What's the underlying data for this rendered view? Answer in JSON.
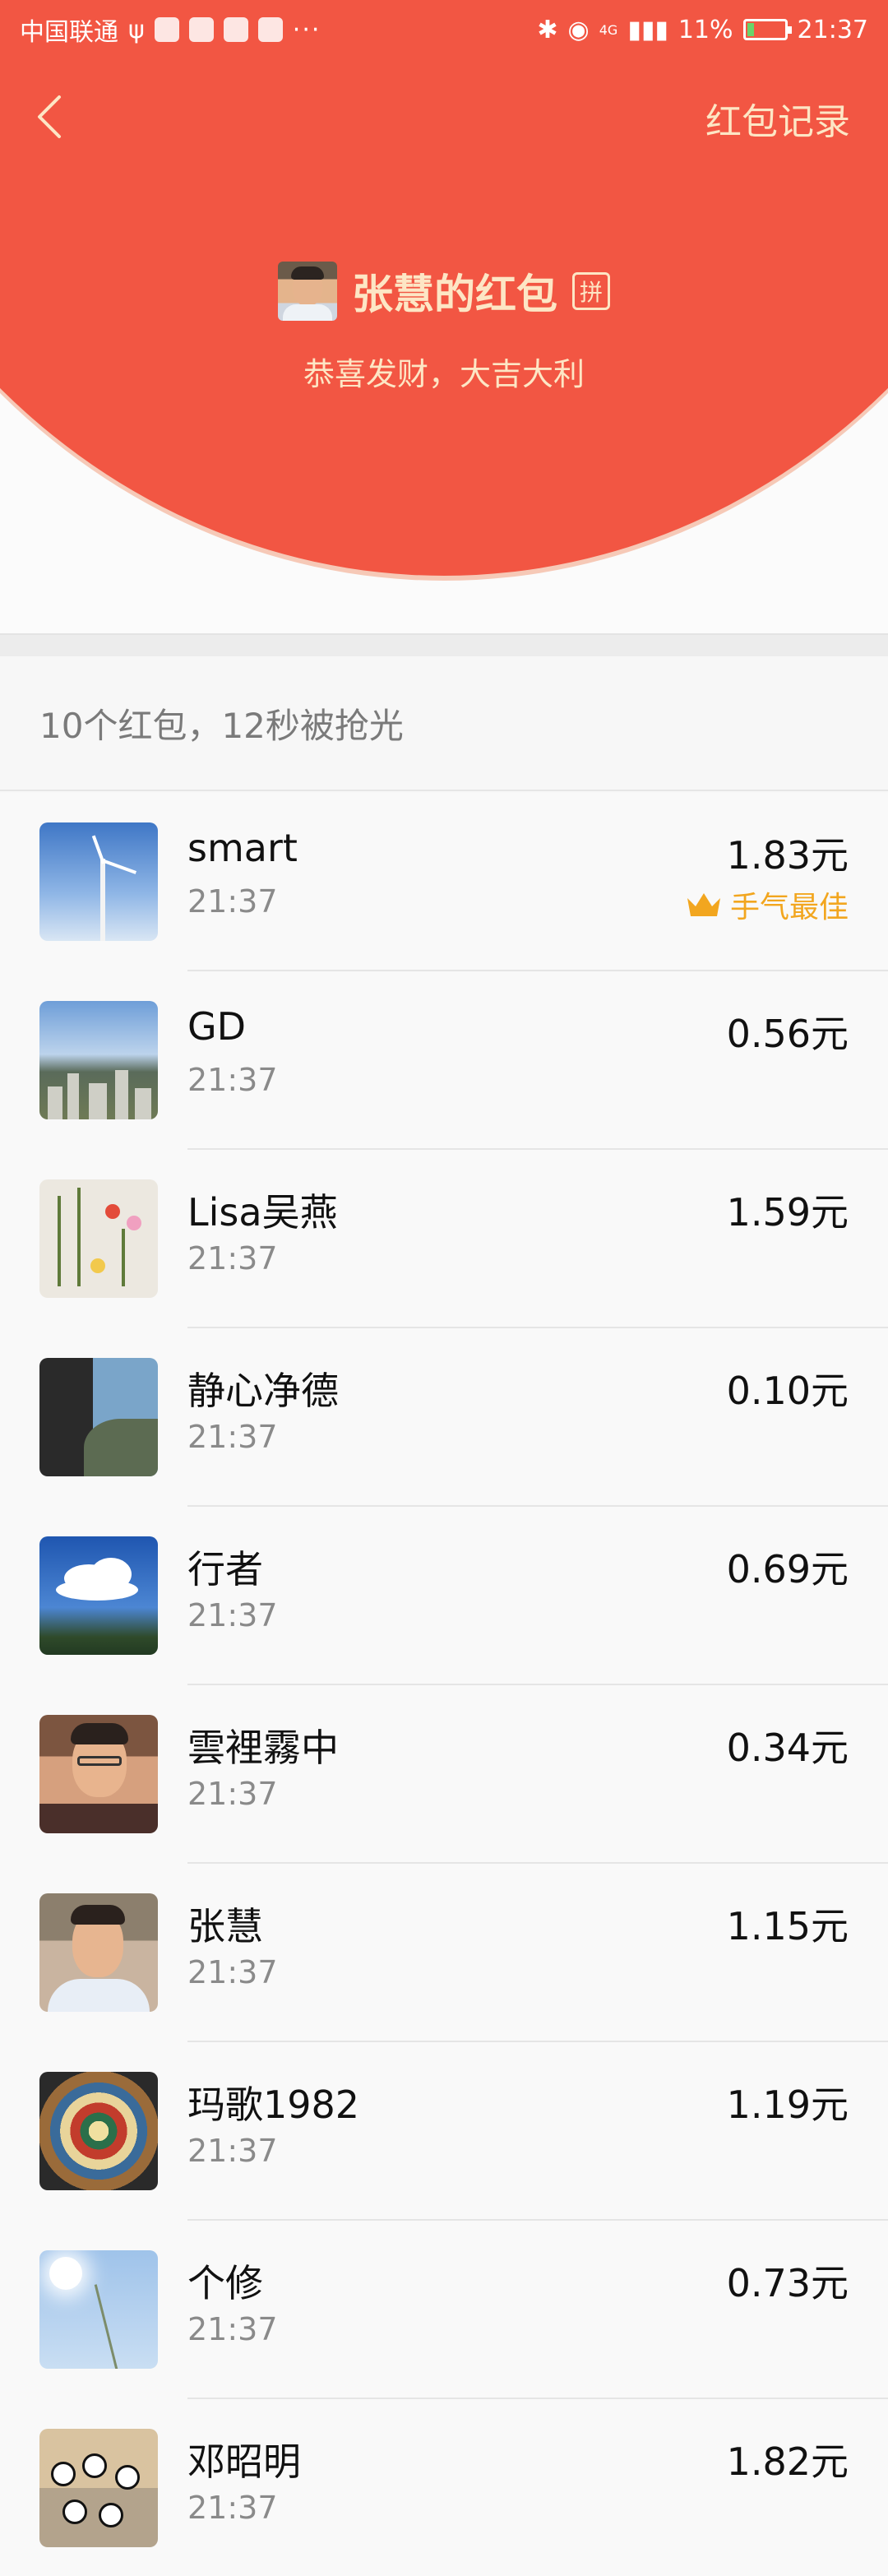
{
  "status_bar": {
    "carrier": "中国联通",
    "battery_percent": "11%",
    "time": "21:37",
    "network": "4G"
  },
  "header": {
    "back_label": "",
    "record_link": "红包记录",
    "title": "张慧的红包",
    "pin_badge": "拼",
    "wish": "恭喜发财，大吉大利",
    "accent_color": "#f25643",
    "text_color": "#fde6c5"
  },
  "summary": "10个红包，12秒被抢光",
  "best_luck_label": "手气最佳",
  "records": [
    {
      "name": "smart",
      "time": "21:37",
      "amount": "1.83元",
      "best": true,
      "avatar": "wind-turbine"
    },
    {
      "name": "GD",
      "time": "21:37",
      "amount": "0.56元",
      "best": false,
      "avatar": "city-skyline"
    },
    {
      "name": "Lisa吴燕",
      "time": "21:37",
      "amount": "1.59元",
      "best": false,
      "avatar": "flower-painting"
    },
    {
      "name": "静心净德",
      "time": "21:37",
      "amount": "0.10元",
      "best": false,
      "avatar": "rock-mountain"
    },
    {
      "name": "行者",
      "time": "21:37",
      "amount": "0.69元",
      "best": false,
      "avatar": "cloud-sky"
    },
    {
      "name": "雲裡霧中",
      "time": "21:37",
      "amount": "0.34元",
      "best": false,
      "avatar": "man-portrait"
    },
    {
      "name": "张慧",
      "time": "21:37",
      "amount": "1.15元",
      "best": false,
      "avatar": "man-portrait-2"
    },
    {
      "name": "玛歌1982",
      "time": "21:37",
      "amount": "1.19元",
      "best": false,
      "avatar": "mandala"
    },
    {
      "name": "个修",
      "time": "21:37",
      "amount": "0.73元",
      "best": false,
      "avatar": "sun-sky"
    },
    {
      "name": "邓昭明",
      "time": "21:37",
      "amount": "1.82元",
      "best": false,
      "avatar": "panda-toys"
    }
  ]
}
